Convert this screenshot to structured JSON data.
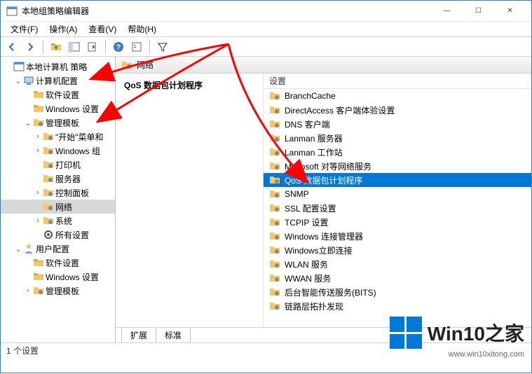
{
  "window": {
    "title": "本地组策略编辑器",
    "min": "—",
    "max": "☐",
    "close": "✕"
  },
  "menu": {
    "file": "文件(F)",
    "action": "操作(A)",
    "view": "查看(V)",
    "help": "帮助(H)"
  },
  "breadcrumb_item": "网络",
  "left_heading": "QoS 数据包计划程序",
  "column_header": "设置",
  "tree": {
    "root": "本地计算机 策略",
    "computer": "计算机配置",
    "software1": "软件设置",
    "windows1": "Windows 设置",
    "admin": "管理模板",
    "startmenu": "\"开始\"菜单和",
    "wincomp": "Windows 组",
    "printer": "打印机",
    "server": "服务器",
    "ctrlpanel": "控制面板",
    "network": "网络",
    "system": "系统",
    "allsettings": "所有设置",
    "user": "用户配置",
    "software2": "软件设置",
    "windows2": "Windows 设置",
    "admin2": "管理模板"
  },
  "list": {
    "i0": "BranchCache",
    "i1": "DirectAccess 客户端体验设置",
    "i2": "DNS 客户端",
    "i3": "Lanman 服务器",
    "i4": "Lanman 工作站",
    "i5": "Microsoft 对等网络服务",
    "i6": "QoS 数据包计划程序",
    "i7": "SNMP",
    "i8": "SSL 配置设置",
    "i9": "TCPIP 设置",
    "i10": "Windows 连接管理器",
    "i11": "Windows立即连接",
    "i12": "WLAN 服务",
    "i13": "WWAN 服务",
    "i14": "后台智能传送服务(BITS)",
    "i15": "链路层拓扑发现"
  },
  "tabs": {
    "extended": "扩展",
    "standard": "标准"
  },
  "status": "1 个设置",
  "watermark": {
    "text": "Win10之家",
    "url": "www.win10xitong.com"
  }
}
